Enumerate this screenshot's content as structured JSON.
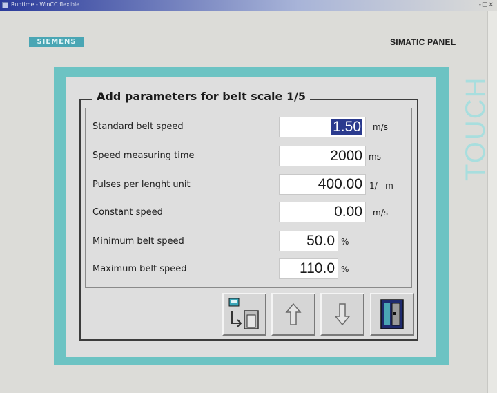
{
  "window": {
    "title": "Runtime - WinCC flexible",
    "controls": "-□×"
  },
  "header": {
    "logo": "SIEMENS",
    "panel_name": "SIMATIC PANEL",
    "touch_label": "TOUCH"
  },
  "form": {
    "title": "Add parameters for belt scale 1/5",
    "rows": [
      {
        "label": "Standard belt speed",
        "value": "1.50",
        "unit": "m/s",
        "selected": true
      },
      {
        "label": "Speed measuring time",
        "value": "2000",
        "unit": "ms"
      },
      {
        "label": "Pulses per lenght unit",
        "value": "400.00",
        "unit": "1/   m"
      },
      {
        "label": "Constant speed",
        "value": "0.00",
        "unit": "m/s"
      },
      {
        "label": "Minimum belt speed",
        "value": "50.0",
        "unit": "%"
      },
      {
        "label": "Maximum belt speed",
        "value": "110.0",
        "unit": "%"
      }
    ]
  },
  "toolbar": {
    "buttons": [
      {
        "icon": "screen-change-icon"
      },
      {
        "icon": "arrow-up-icon"
      },
      {
        "icon": "arrow-down-icon"
      },
      {
        "icon": "exit-door-icon"
      }
    ]
  },
  "colors": {
    "frame": "#6cc3c3",
    "selection": "#2a3a8e",
    "logo": "#4aa6b4"
  }
}
